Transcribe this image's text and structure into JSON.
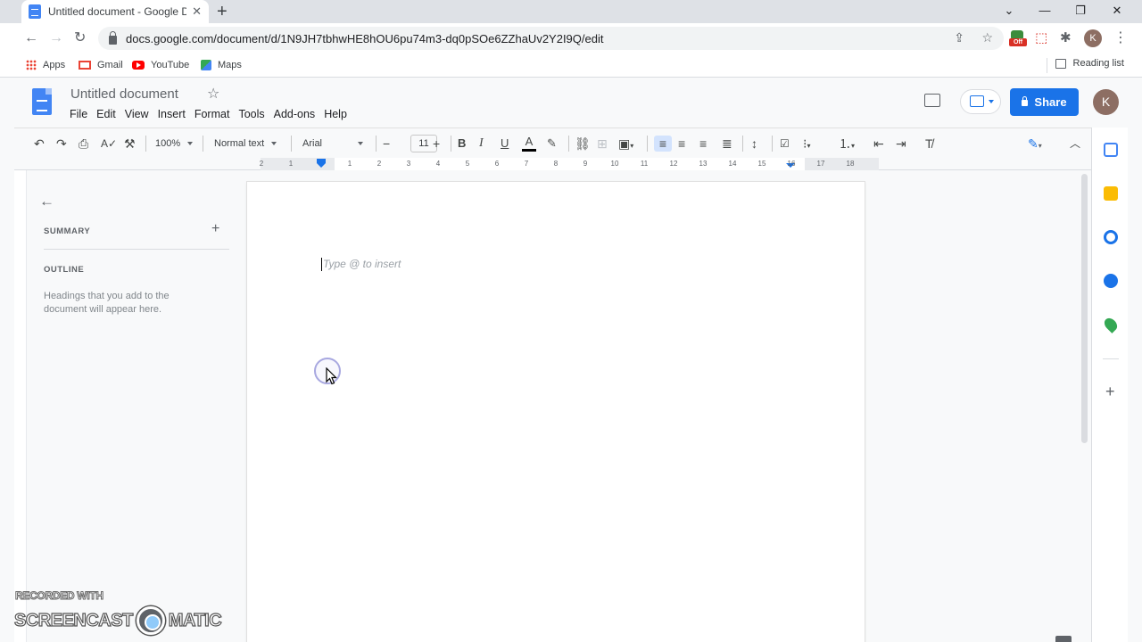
{
  "browser": {
    "tab_title": "Untitled document - Google Docs",
    "tab_close": "✕",
    "new_tab": "+",
    "window_controls": [
      "⌄",
      "—",
      "❐",
      "✕"
    ],
    "url": "docs.google.com/document/d/1N9JH7tbhwHE8hOU6pu74m3-dq0pSOe6ZZhaUv2Y2I9Q/edit",
    "extension_badge": "Off",
    "profile_initial": "K",
    "bookmarks": [
      "Apps",
      "Gmail",
      "YouTube",
      "Maps"
    ],
    "reading_list": "Reading list"
  },
  "docs": {
    "title": "Untitled document",
    "menu": [
      "File",
      "Edit",
      "View",
      "Insert",
      "Format",
      "Tools",
      "Add-ons",
      "Help"
    ],
    "share_label": "Share",
    "avatar_initial": "K"
  },
  "toolbar": {
    "zoom": "100%",
    "style": "Normal text",
    "font": "Arial",
    "font_size": "11"
  },
  "ruler": {
    "ticks": [
      "2",
      "1",
      "1",
      "2",
      "3",
      "4",
      "5",
      "6",
      "7",
      "8",
      "9",
      "10",
      "11",
      "12",
      "13",
      "14",
      "15",
      "16",
      "17",
      "18"
    ]
  },
  "outline_panel": {
    "summary_label": "SUMMARY",
    "outline_label": "OUTLINE",
    "hint": "Headings that you add to the document will appear here."
  },
  "page": {
    "placeholder": "Type @ to insert"
  },
  "watermark": {
    "line1": "RECORDED WITH",
    "left": "SCREENCAST",
    "right": "MATIC"
  },
  "colors": {
    "accent": "#1a73e8",
    "docs_blue": "#4285f4",
    "avatar": "#8d6e63"
  }
}
